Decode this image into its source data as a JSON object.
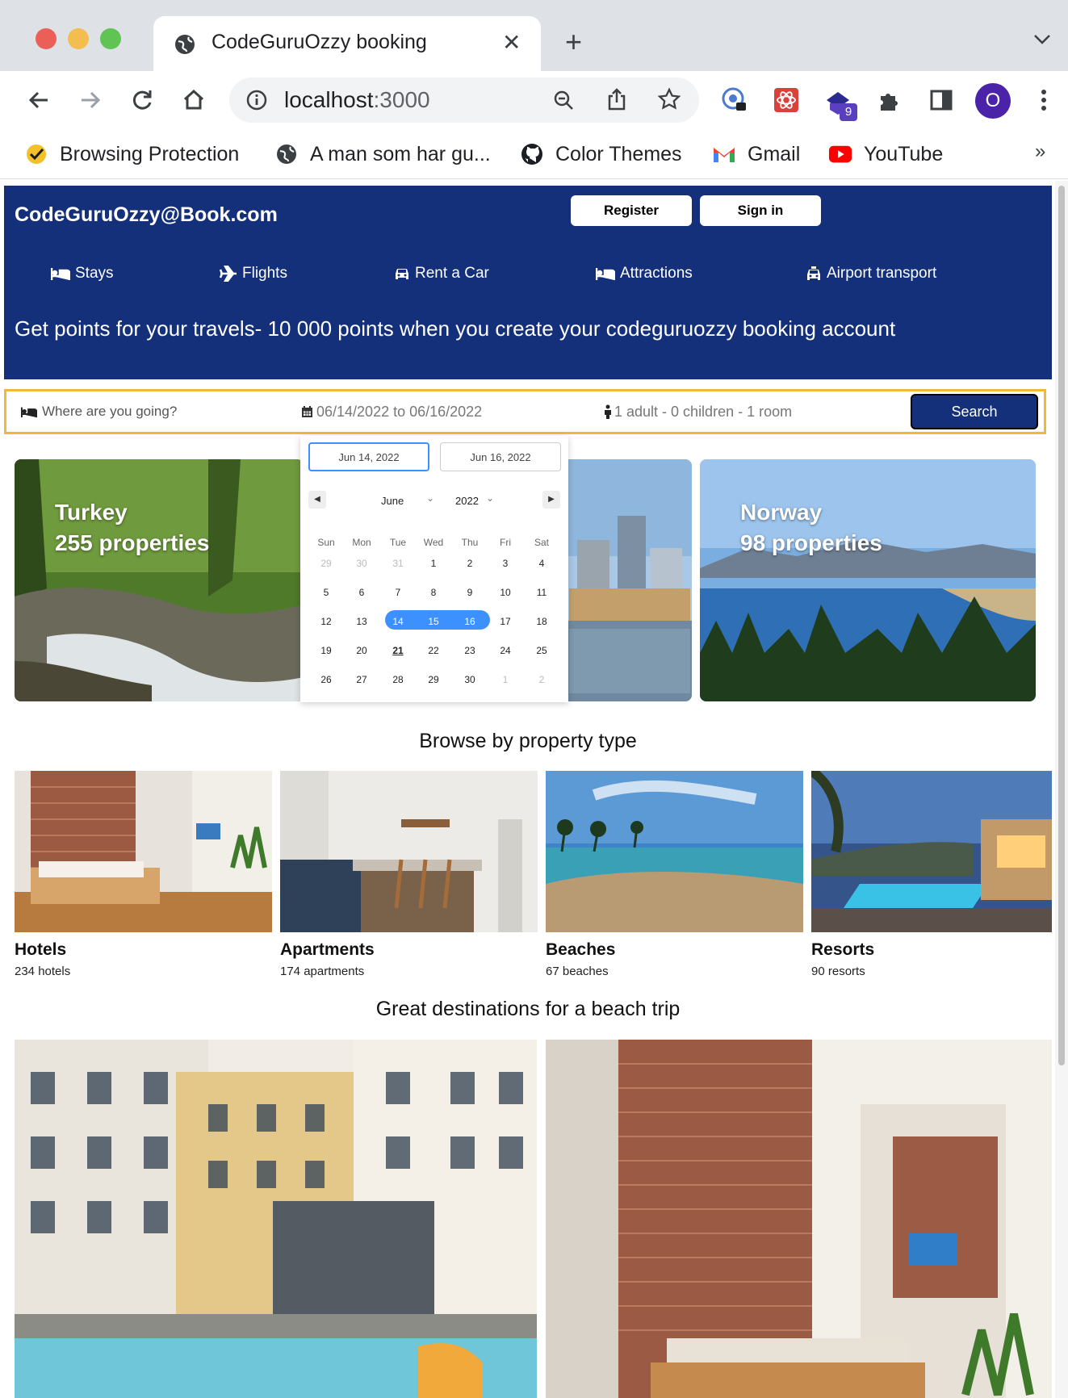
{
  "browser": {
    "tab_title": "CodeGuruOzzy booking",
    "url_host": "localhost",
    "url_port": ":3000",
    "profile_initial": "O",
    "extension_badge": "9",
    "bookmarks": [
      {
        "label": "Browsing Protection",
        "icon": "shield-check-icon"
      },
      {
        "label": "A man som har gu...",
        "icon": "globe-icon"
      },
      {
        "label": "Color Themes",
        "icon": "github-icon"
      },
      {
        "label": "Gmail",
        "icon": "gmail-icon"
      },
      {
        "label": "YouTube",
        "icon": "youtube-icon"
      }
    ],
    "more_bookmarks": "»"
  },
  "site": {
    "logo": "CodeGuruOzzy@Book.com",
    "register_label": "Register",
    "signin_label": "Sign in",
    "nav": [
      {
        "label": "Stays",
        "icon": "bed-icon"
      },
      {
        "label": "Flights",
        "icon": "plane-icon"
      },
      {
        "label": "Rent a Car",
        "icon": "car-icon"
      },
      {
        "label": "Attractions",
        "icon": "bed-icon"
      },
      {
        "label": "Airport transport",
        "icon": "taxi-icon"
      }
    ],
    "promo": "Get points for your travels- 10 000 points when you create your codeguruozzy booking account"
  },
  "search": {
    "destination_placeholder": "Where are you going?",
    "dates": "06/14/2022 to 06/16/2022",
    "guests": "1 adult - 0 children - 1 room",
    "button": "Search"
  },
  "calendar": {
    "start_input": "Jun 14, 2022",
    "end_input": "Jun 16, 2022",
    "month": "June",
    "year": "2022",
    "weekdays": [
      "Sun",
      "Mon",
      "Tue",
      "Wed",
      "Thu",
      "Fri",
      "Sat"
    ],
    "weeks": [
      [
        "29",
        "30",
        "31",
        "1",
        "2",
        "3",
        "4"
      ],
      [
        "5",
        "6",
        "7",
        "8",
        "9",
        "10",
        "11"
      ],
      [
        "12",
        "13",
        "14",
        "15",
        "16",
        "17",
        "18"
      ],
      [
        "19",
        "20",
        "21",
        "22",
        "23",
        "24",
        "25"
      ],
      [
        "26",
        "27",
        "28",
        "29",
        "30",
        "1",
        "2"
      ]
    ],
    "selected_range": [
      "14",
      "15",
      "16"
    ],
    "today": "21"
  },
  "featured": [
    {
      "name": "Turkey",
      "count": "255 properties"
    },
    {
      "name": "Norway",
      "count": "98 properties"
    }
  ],
  "property_section_title": "Browse by property type",
  "property_types": [
    {
      "name": "Hotels",
      "count": "234 hotels"
    },
    {
      "name": "Apartments",
      "count": "174 apartments"
    },
    {
      "name": "Beaches",
      "count": "67 beaches"
    },
    {
      "name": "Resorts",
      "count": "90 resorts"
    }
  ],
  "beach_section_title": "Great destinations for a beach trip"
}
